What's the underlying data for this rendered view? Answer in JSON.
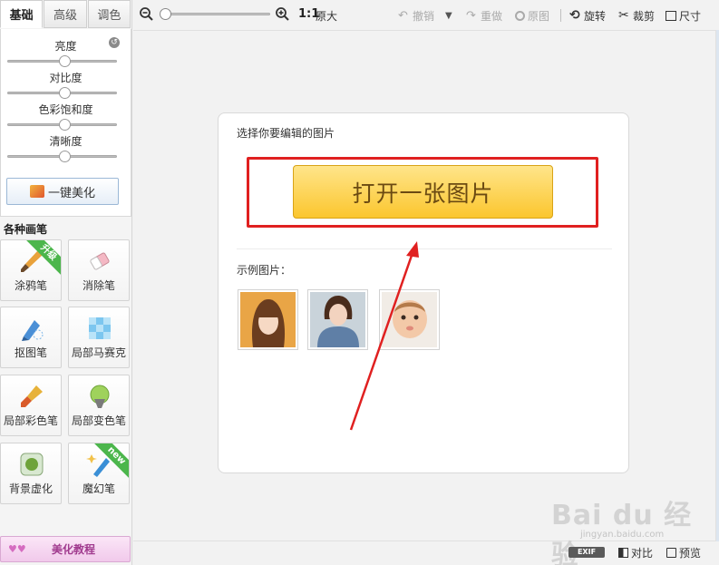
{
  "tabs": [
    {
      "label": "基础",
      "active": true
    },
    {
      "label": "高级",
      "active": false
    },
    {
      "label": "调色",
      "active": false
    }
  ],
  "sliders": [
    {
      "label": "亮度",
      "level": 0.5
    },
    {
      "label": "对比度",
      "level": 0.5
    },
    {
      "label": "色彩饱和度",
      "level": 0.5
    },
    {
      "label": "清晰度",
      "level": 0.5
    }
  ],
  "one_click_label": "一键美化",
  "brushes_title": "各种画笔",
  "brushes": [
    {
      "label": "涂鸦笔",
      "icon": "paint-brush-icon",
      "badge": "升级"
    },
    {
      "label": "消除笔",
      "icon": "eraser-icon",
      "badge": ""
    },
    {
      "label": "抠图笔",
      "icon": "cutout-pen-icon",
      "badge": ""
    },
    {
      "label": "局部马赛克",
      "icon": "mosaic-icon",
      "badge": ""
    },
    {
      "label": "局部彩色笔",
      "icon": "color-brush-icon",
      "badge": ""
    },
    {
      "label": "局部变色笔",
      "icon": "recolor-icon",
      "badge": ""
    },
    {
      "label": "背景虚化",
      "icon": "blur-icon",
      "badge": ""
    },
    {
      "label": "魔幻笔",
      "icon": "magic-wand-icon",
      "badge": "new"
    }
  ],
  "tutorial_label": "美化教程",
  "toolbar": {
    "ratio": "1:1",
    "original_size": "原大",
    "undo": "撤销",
    "redo": "重做",
    "original": "原图",
    "rotate": "旋转",
    "crop": "裁剪",
    "resize": "尺寸"
  },
  "card": {
    "title": "选择你要编辑的图片",
    "open_button": "打开一张图片",
    "examples_title": "示例图片："
  },
  "bottom": {
    "exif": "EXIF",
    "compare": "对比",
    "preview": "预览"
  },
  "watermark": {
    "brand": "Bai du 经验",
    "url": "jingyan.baidu.com"
  },
  "colors": {
    "open_button": "#fbc62e",
    "highlight": "#e02020",
    "arrow": "#e02020"
  }
}
